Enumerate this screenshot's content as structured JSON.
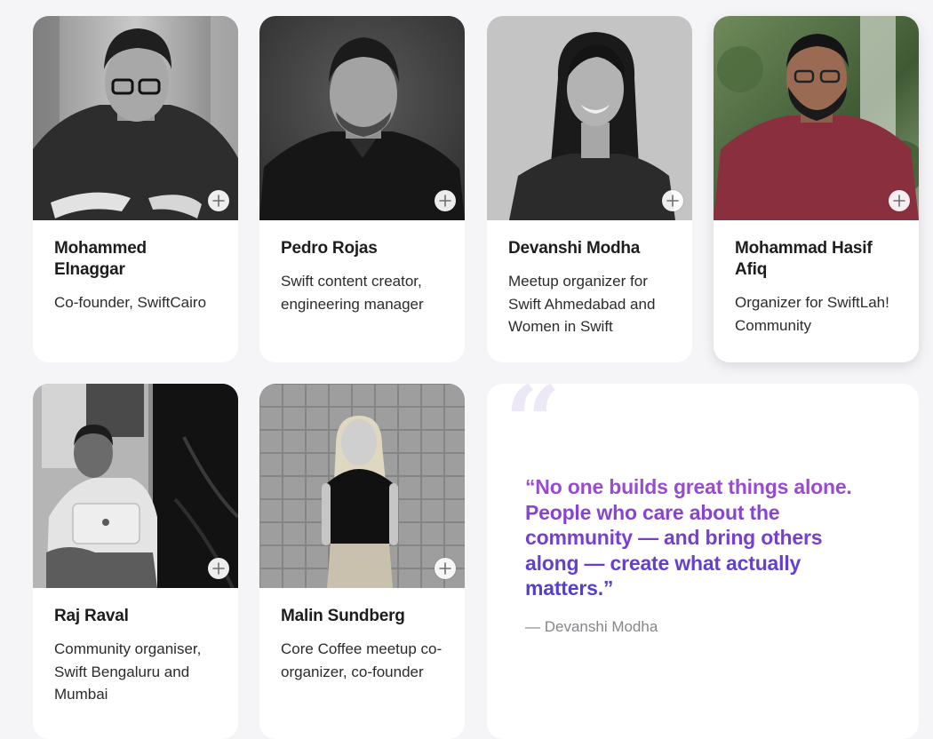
{
  "people": [
    {
      "name": "Mohammed Elnaggar",
      "role": "Co-founder, SwiftCairo"
    },
    {
      "name": "Pedro Rojas",
      "role": "Swift content creator, engineering manager"
    },
    {
      "name": "Devanshi Modha",
      "role": "Meetup organizer for Swift Ahmedabad and Women in Swift"
    },
    {
      "name": "Mohammad Hasif Afiq",
      "role": "Organizer for SwiftLah! Community"
    },
    {
      "name": "Raj Raval",
      "role": "Community organiser, Swift Bengaluru and Mumbai"
    },
    {
      "name": "Malin Sundberg",
      "role": "Core Coffee meetup co-organizer, co-founder"
    }
  ],
  "quote": {
    "mark": "“",
    "text": "“No one builds great things alone. People who care about the community — and bring others along — create what actually matters.”",
    "author": "— Devanshi Modha"
  },
  "icons": {
    "expand": "plus-icon",
    "quote": "quote-mark-icon"
  },
  "colors": {
    "background": "#f5f5f7",
    "card": "#ffffff",
    "quote_gradient_start": "#a14fd0",
    "quote_gradient_end": "#4b3fcf",
    "author_text": "#86868b"
  }
}
